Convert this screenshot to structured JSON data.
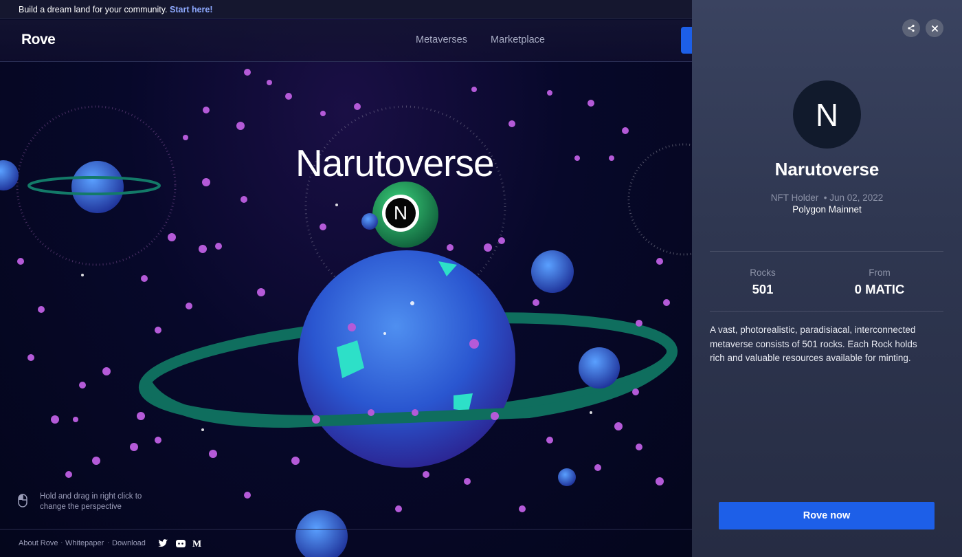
{
  "banner": {
    "text": "Build a dream land for your community.",
    "link": "Start here!"
  },
  "nav": {
    "logo": "Rove",
    "links": [
      "Metaverses",
      "Marketplace"
    ]
  },
  "scene": {
    "title": "Narutoverse",
    "marker_letter": "N",
    "hint": "Hold and drag in right click to change the perspective"
  },
  "footer": {
    "links": [
      "About Rove",
      "Whitepaper",
      "Download"
    ],
    "social_icons": [
      "twitter-icon",
      "discord-icon",
      "medium-icon"
    ]
  },
  "panel": {
    "avatar_letter": "N",
    "title": "Narutoverse",
    "holder": "NFT Holder",
    "date": "Jun 02, 2022",
    "network": "Polygon Mainnet",
    "stats": [
      {
        "label": "Rocks",
        "value": "501"
      },
      {
        "label": "From",
        "value": "0 MATIC"
      }
    ],
    "description": "A vast, photorealistic, paradisiacal, interconnected metaverse consists of 501 rocks. Each Rock holds rich and valuable resources available for minting.",
    "cta": "Rove now",
    "icons": [
      "share-icon",
      "close-icon"
    ]
  },
  "colors": {
    "accent": "#1d5fe8",
    "space": "#05071f",
    "planet": "#2b5ad6",
    "ring": "#0f6e5e",
    "particle": "#b45ad8"
  }
}
